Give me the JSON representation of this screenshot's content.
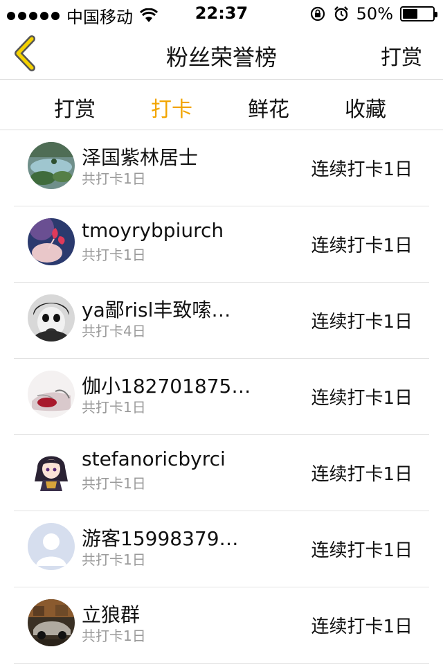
{
  "status_bar": {
    "carrier": "中国移动",
    "time": "22:37",
    "battery_percent": "50%",
    "battery_level": 0.5
  },
  "nav": {
    "back_icon": "chevron-left-icon",
    "title": "粉丝荣誉榜",
    "right_action": "打赏"
  },
  "tabs": [
    {
      "label": "打赏",
      "active": false
    },
    {
      "label": "打卡",
      "active": true
    },
    {
      "label": "鲜花",
      "active": false
    },
    {
      "label": "收藏",
      "active": false
    }
  ],
  "colors": {
    "accent": "#f2a500",
    "back_chevron": "#f5d200",
    "secondary_text": "#9a9a9a",
    "divider": "#e2e2e2"
  },
  "users": [
    {
      "name": "泽国紫林居士",
      "total": "共打卡1日",
      "streak": "连续打卡1日",
      "avatar": "landscape-avatar"
    },
    {
      "name": "tmoyrybpiurch",
      "total": "共打卡1日",
      "streak": "连续打卡1日",
      "avatar": "flower-hand-avatar"
    },
    {
      "name": "ya鄙risl丰致嗦…",
      "total": "共打卡4日",
      "streak": "连续打卡1日",
      "avatar": "clown-face-avatar"
    },
    {
      "name": "伽小182701875…",
      "total": "共打卡1日",
      "streak": "连续打卡1日",
      "avatar": "red-sketch-avatar"
    },
    {
      "name": "stefanoricbyrci",
      "total": "共打卡1日",
      "streak": "连续打卡1日",
      "avatar": "anime-girl-avatar"
    },
    {
      "name": "游客15998379…",
      "total": "共打卡1日",
      "streak": "连续打卡1日",
      "avatar": "default-user-avatar"
    },
    {
      "name": "立狼群",
      "total": "共打卡1日",
      "streak": "连续打卡1日",
      "avatar": "car-avatar"
    }
  ]
}
